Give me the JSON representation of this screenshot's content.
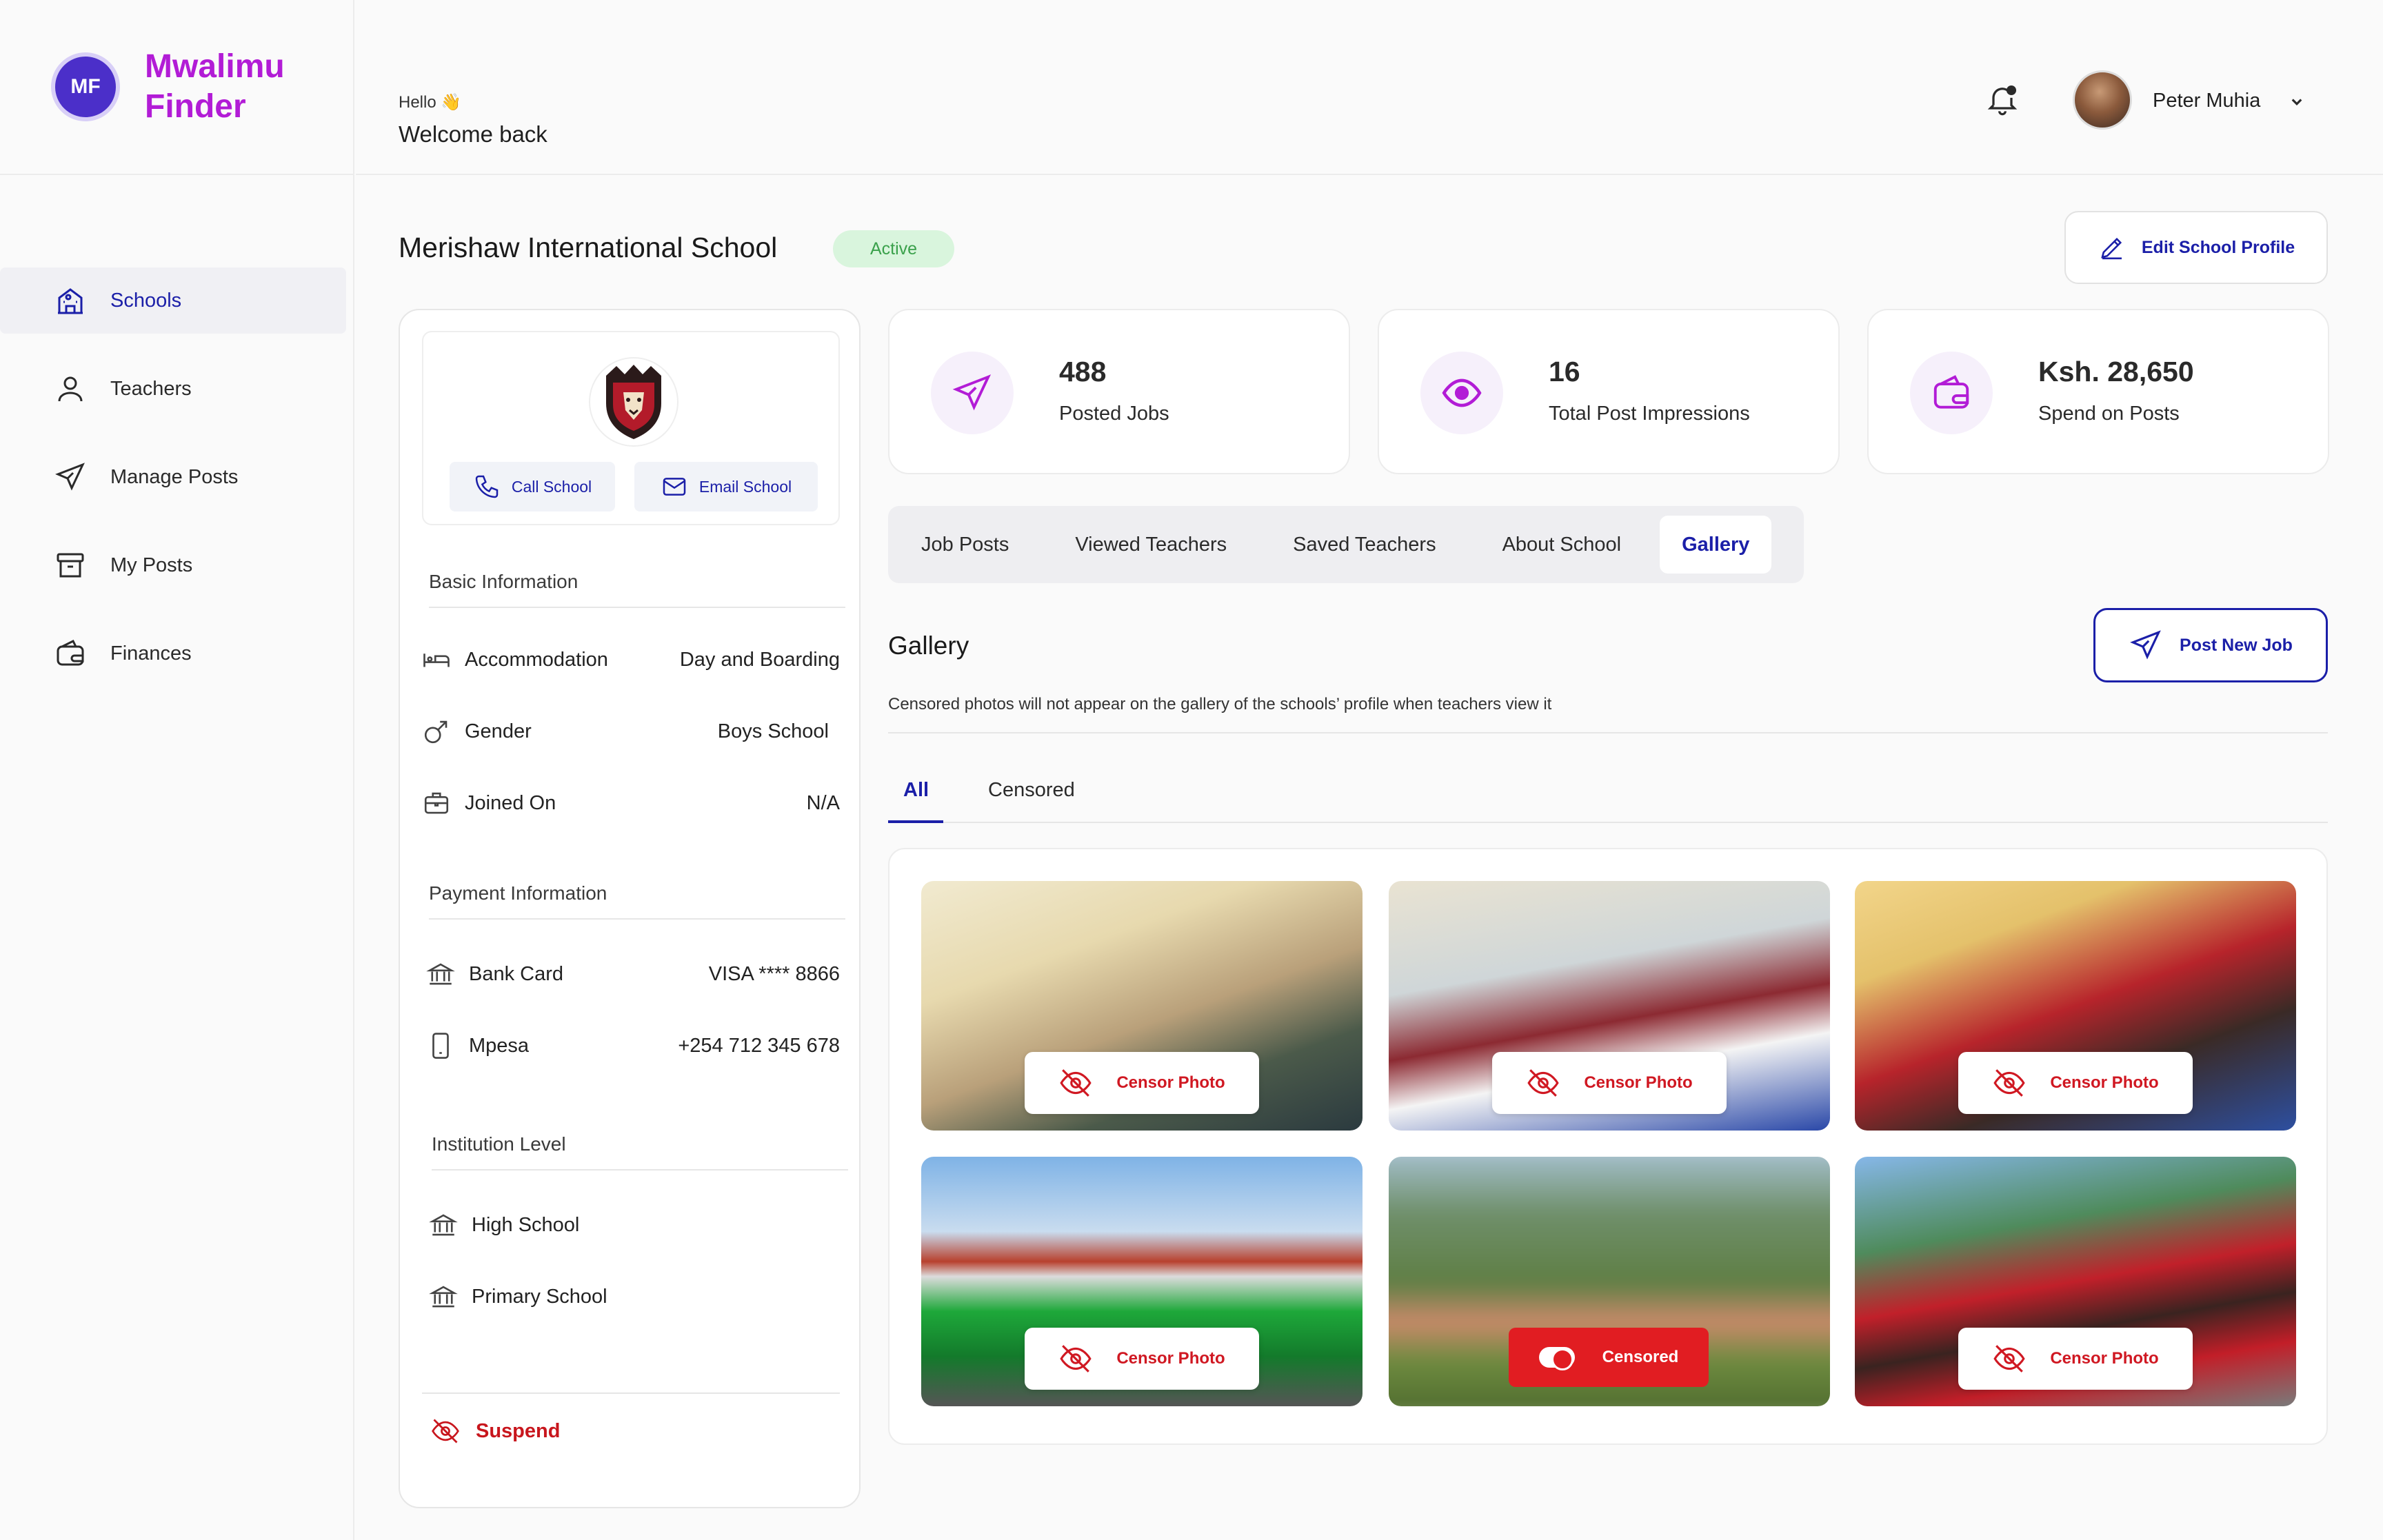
{
  "app": {
    "name": "Mwalimu Finder"
  },
  "sidebar": {
    "items": [
      {
        "label": "Schools",
        "icon": "school-icon",
        "active": true
      },
      {
        "label": "Teachers",
        "icon": "user-icon"
      },
      {
        "label": "Manage Posts",
        "icon": "send-icon"
      },
      {
        "label": "My Posts",
        "icon": "archive-icon"
      },
      {
        "label": "Finances",
        "icon": "wallet-icon"
      }
    ]
  },
  "header": {
    "hello": "Hello 👋",
    "welcome": "Welcome back",
    "user_name": "Peter Muhia"
  },
  "school": {
    "name": "Merishaw International School",
    "status": "Active",
    "edit_label": "Edit School Profile"
  },
  "profile": {
    "call_label": "Call School",
    "email_label": "Email School",
    "basic_title": "Basic Information",
    "basic": [
      {
        "label": "Accommodation",
        "value": "Day and Boarding"
      },
      {
        "label": "Gender",
        "value": "Boys School"
      },
      {
        "label": "Joined On",
        "value": "N/A"
      }
    ],
    "payment_title": "Payment Information",
    "payment": [
      {
        "label": "Bank Card",
        "value": "VISA **** 8866"
      },
      {
        "label": "Mpesa",
        "value": "+254 712 345 678"
      }
    ],
    "level_title": "Institution Level",
    "levels": [
      {
        "label": "High School"
      },
      {
        "label": "Primary School"
      }
    ],
    "suspend_label": "Suspend"
  },
  "stats": [
    {
      "value": "488",
      "label": "Posted Jobs",
      "icon": "send-icon"
    },
    {
      "value": "16",
      "label": "Total Post Impressions",
      "icon": "eye-icon"
    },
    {
      "value": "Ksh. 28,650",
      "label": "Spend on Posts",
      "icon": "wallet-icon"
    }
  ],
  "tabs": [
    {
      "label": "Job Posts"
    },
    {
      "label": "Viewed Teachers"
    },
    {
      "label": "Saved Teachers"
    },
    {
      "label": "About School"
    },
    {
      "label": "Gallery",
      "active": true
    }
  ],
  "gallery": {
    "title": "Gallery",
    "post_job_label": "Post New Job",
    "note": "Censored photos will not appear on the gallery of the schools’ profile when teachers view it",
    "subtabs": {
      "all": "All",
      "censored": "Censored"
    },
    "censor_label": "Censor Photo",
    "censored_label": "Censored"
  },
  "colors": {
    "accent": "#1b1fa8",
    "brand": "#b21cd6",
    "danger": "#d01822",
    "active_badge_bg": "#d9f5dd",
    "active_badge_text": "#3aa14b"
  }
}
